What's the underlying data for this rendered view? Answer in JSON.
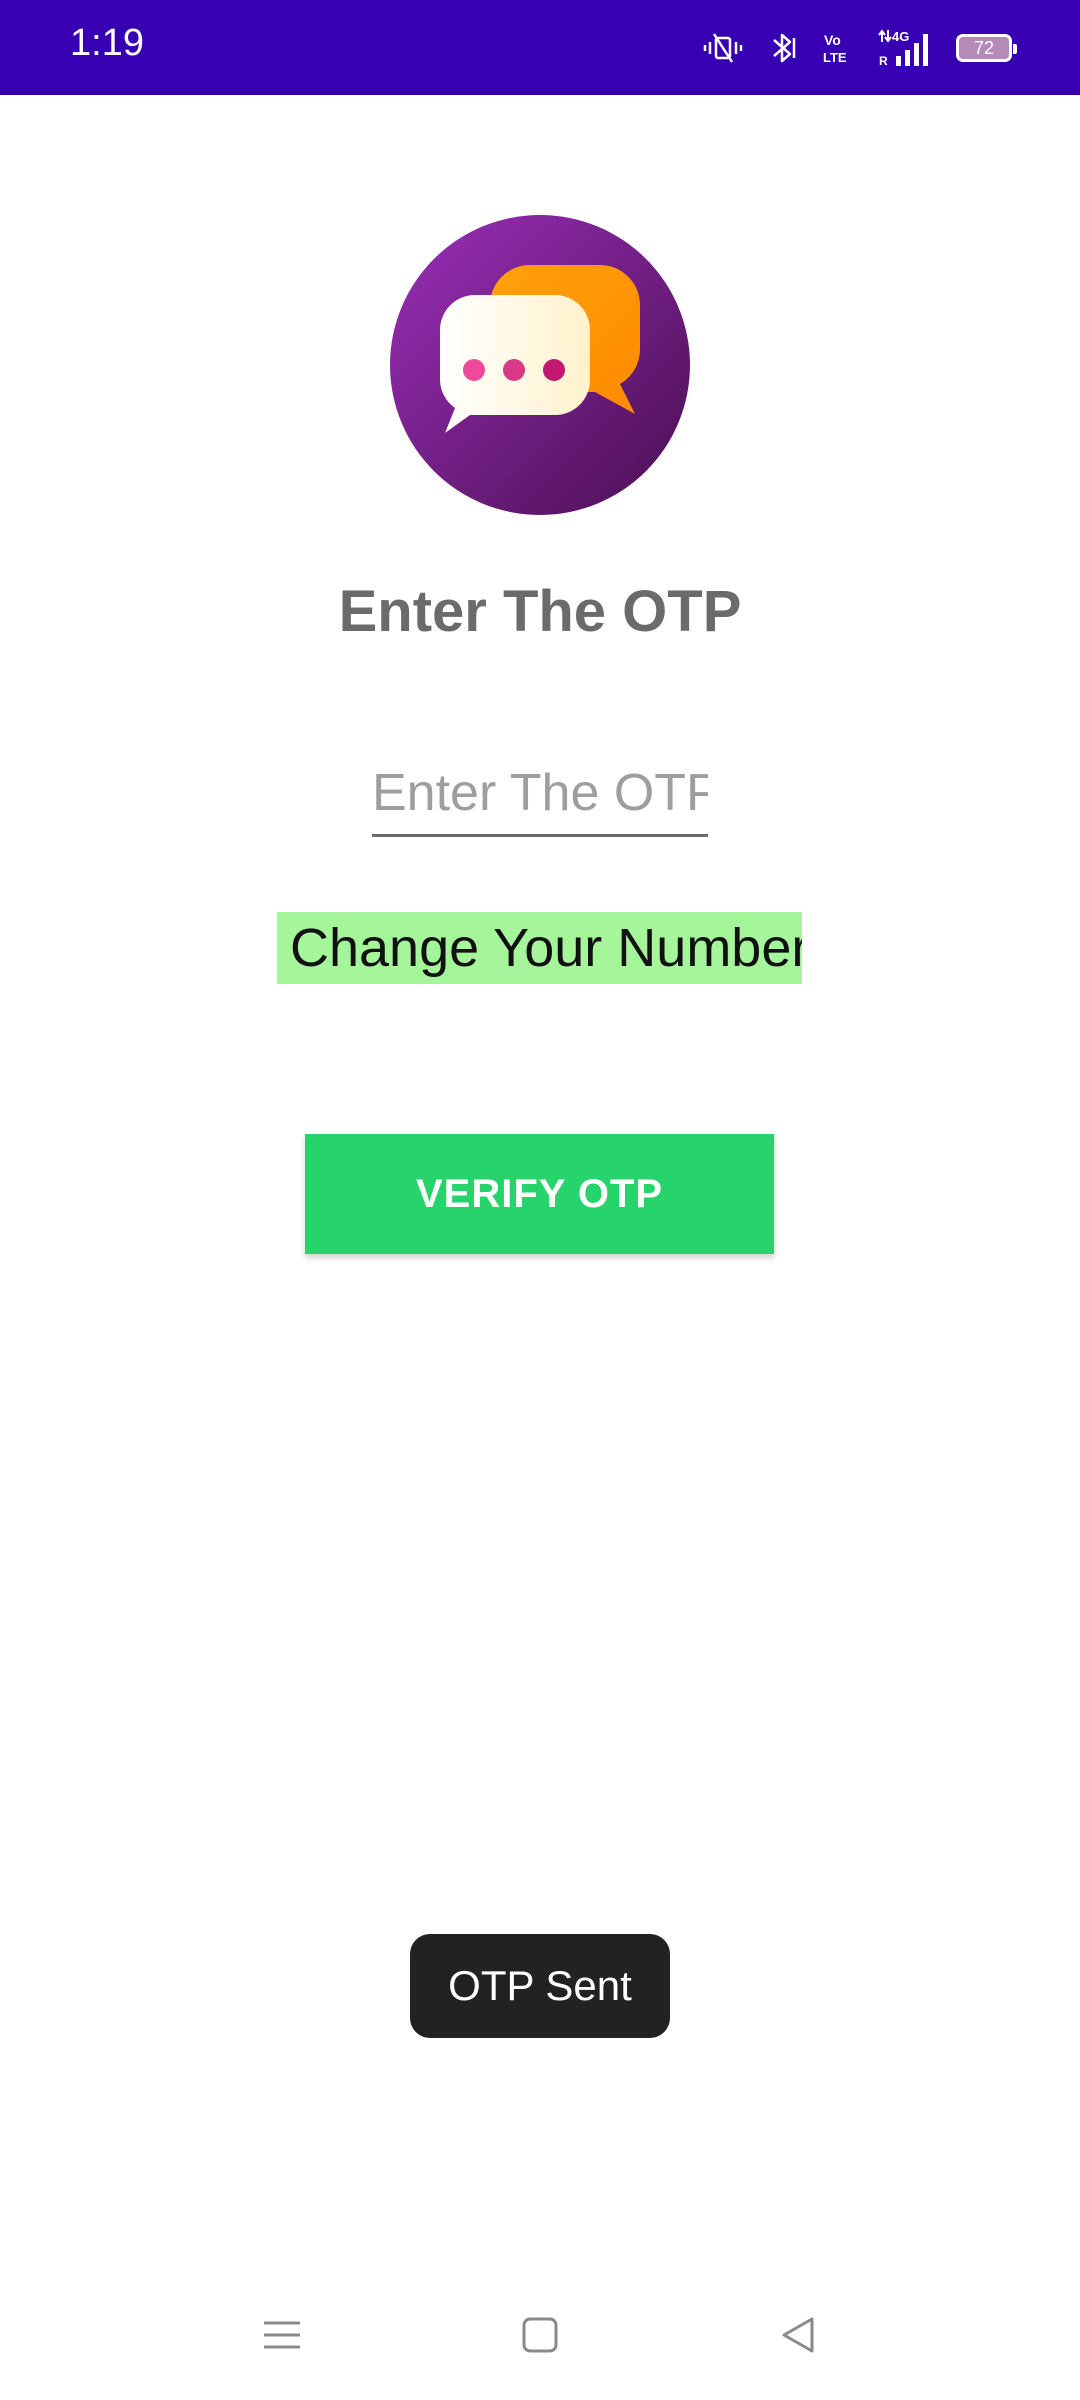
{
  "status_bar": {
    "time": "1:19",
    "battery_level": "72",
    "background_color": "#3700b3",
    "icons": [
      "vibrate-mute-icon",
      "bluetooth-icon",
      "volte-icon",
      "signal-4g-icon",
      "battery-icon"
    ],
    "volte_label_top": "Vo",
    "volte_label_bottom": "LTE",
    "network_label": "4G",
    "roaming_label": "R"
  },
  "app": {
    "logo_icon": "chat-bubbles-logo-icon",
    "title": "Enter The OTP",
    "otp_input": {
      "value": "",
      "placeholder": "Enter The OTP"
    },
    "change_number_label": "Change Your Number",
    "verify_button_label": "VERIFY OTP",
    "accent_color": "#27d46b",
    "highlight_color": "#a5f59a"
  },
  "toast": {
    "message": "OTP Sent"
  },
  "nav_bar": {
    "buttons": [
      "menu-icon",
      "home-icon",
      "back-icon"
    ]
  }
}
